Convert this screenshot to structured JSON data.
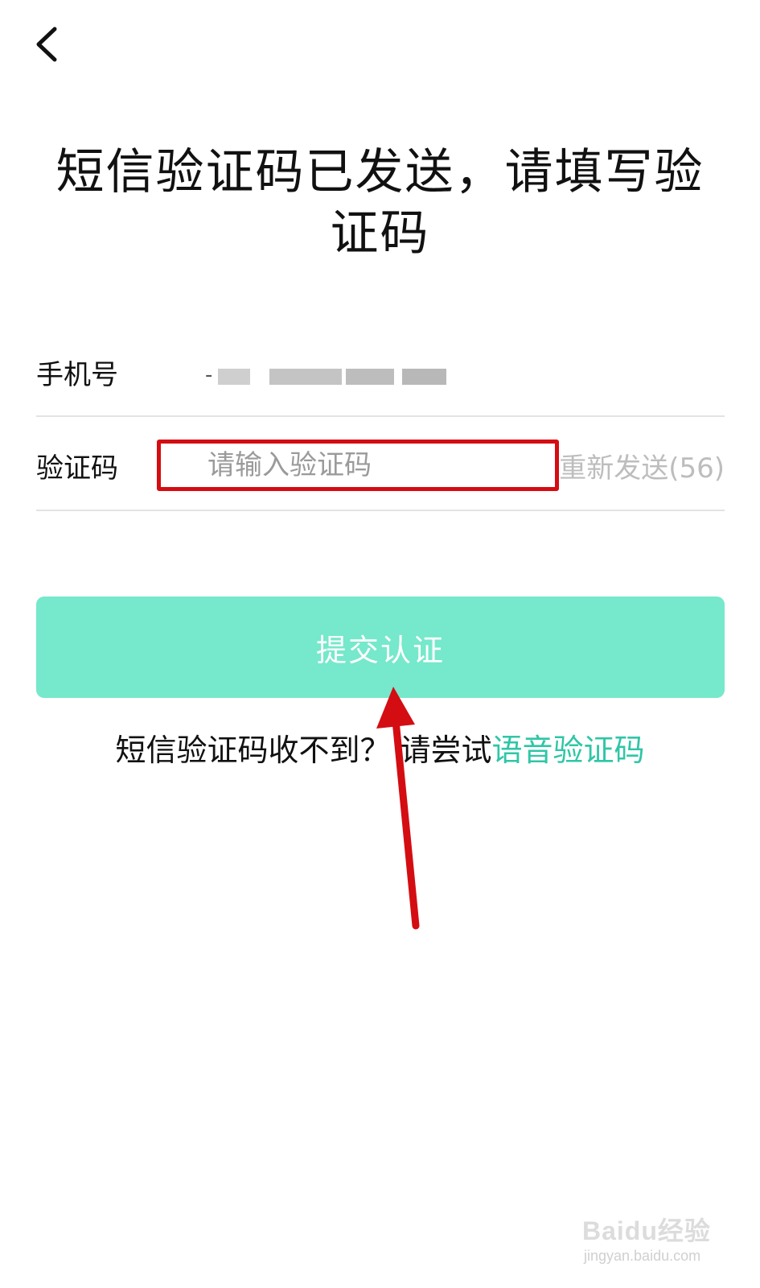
{
  "header": {
    "back_icon": "chevron-left-icon"
  },
  "title": "短信验证码已发送，请填写验证码",
  "form": {
    "phone_label": "手机号",
    "phone_value_masked": "-",
    "code_label": "验证码",
    "code_placeholder": "请输入验证码",
    "resend_label": "重新发送(56)"
  },
  "submit": {
    "label": "提交认证"
  },
  "voice": {
    "prompt": "短信验证码收不到？ 请尝试",
    "link": "语音验证码"
  },
  "colors": {
    "accent": "#2fc6a6",
    "button_bg": "#76e8cb",
    "highlight_box": "#d40d12",
    "arrow": "#d40d12"
  },
  "watermark": {
    "brand": "Baidu经验",
    "url": "jingyan.baidu.com"
  }
}
